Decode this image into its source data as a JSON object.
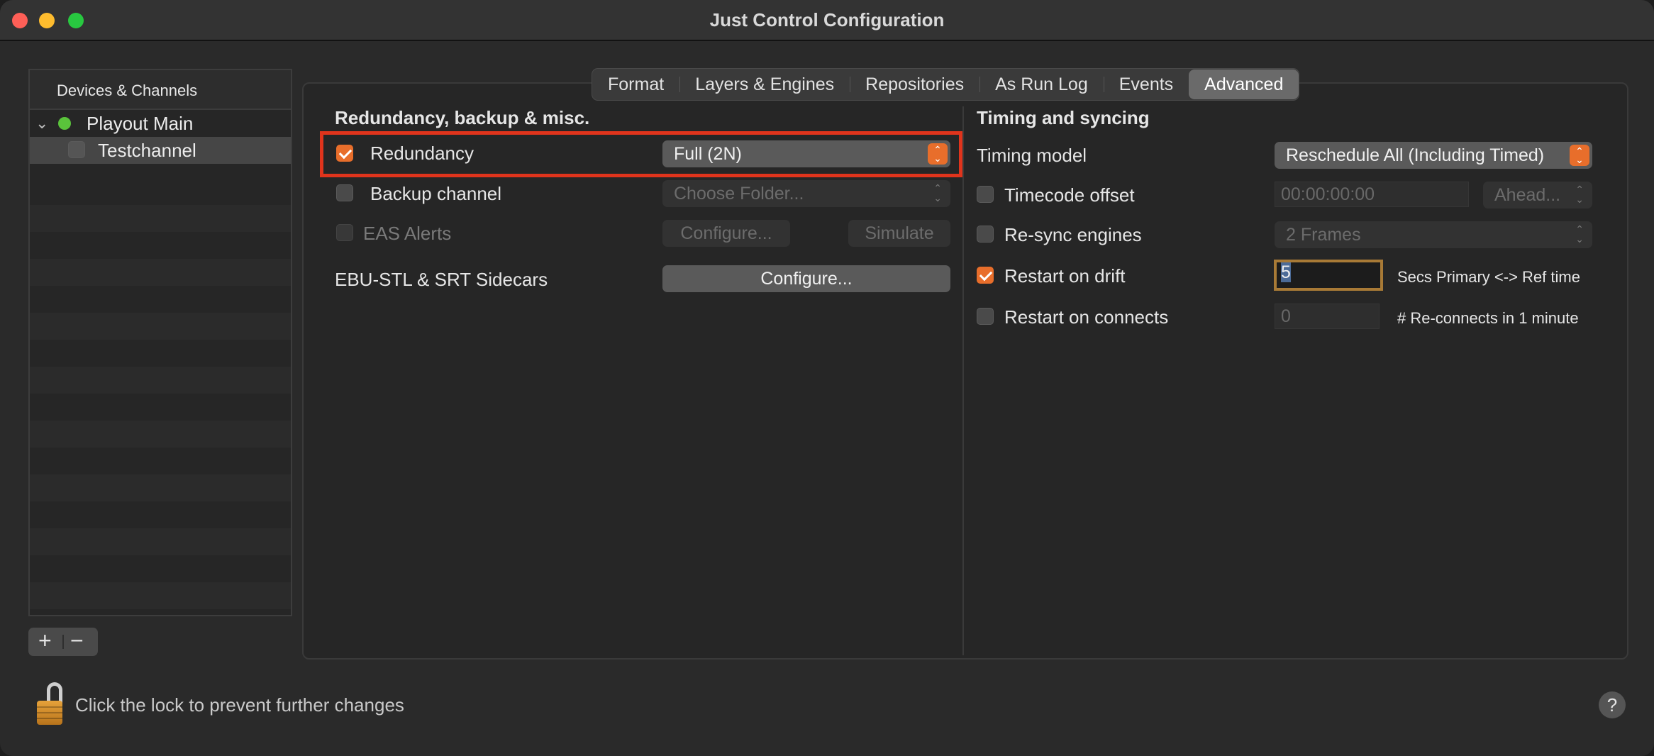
{
  "window": {
    "title": "Just Control Configuration"
  },
  "sidebar": {
    "header": "Devices & Channels",
    "items": [
      {
        "label": "Playout Main",
        "status_color": "#5ac33b",
        "expanded": true
      },
      {
        "label": "Testchannel",
        "checked": false,
        "selected": true
      }
    ],
    "add_label": "+",
    "remove_label": "−"
  },
  "tabs": [
    {
      "label": "Format",
      "active": false
    },
    {
      "label": "Layers & Engines",
      "active": false
    },
    {
      "label": "Repositories",
      "active": false
    },
    {
      "label": "As Run Log",
      "active": false
    },
    {
      "label": "Events",
      "active": false
    },
    {
      "label": "Advanced",
      "active": true
    }
  ],
  "left_section": {
    "title": "Redundancy, backup & misc.",
    "redundancy": {
      "label": "Redundancy",
      "checked": true,
      "value": "Full (2N)"
    },
    "backup": {
      "label": "Backup channel",
      "checked": false,
      "value": "Choose Folder..."
    },
    "eas": {
      "label": "EAS Alerts",
      "checked": false,
      "configure_label": "Configure...",
      "simulate_label": "Simulate"
    },
    "sidecars": {
      "label": "EBU-STL & SRT Sidecars",
      "configure_label": "Configure..."
    }
  },
  "right_section": {
    "title": "Timing and syncing",
    "timing_model": {
      "label": "Timing model",
      "value": "Reschedule All (Including Timed)"
    },
    "timecode_offset": {
      "label": "Timecode offset",
      "checked": false,
      "value": "00:00:00:00",
      "direction": "Ahead..."
    },
    "resync": {
      "label": "Re-sync engines",
      "checked": false,
      "value": "2 Frames"
    },
    "restart_drift": {
      "label": "Restart on drift",
      "checked": true,
      "value": "5",
      "suffix": "Secs Primary <-> Ref time"
    },
    "restart_connects": {
      "label": "Restart on connects",
      "checked": false,
      "value": "0",
      "suffix": "# Re-connects in 1 minute"
    }
  },
  "footer": {
    "lock_text": "Click the lock to prevent further changes",
    "help_label": "?"
  },
  "colors": {
    "accent": "#e86e2b",
    "highlight": "#e0341c"
  }
}
